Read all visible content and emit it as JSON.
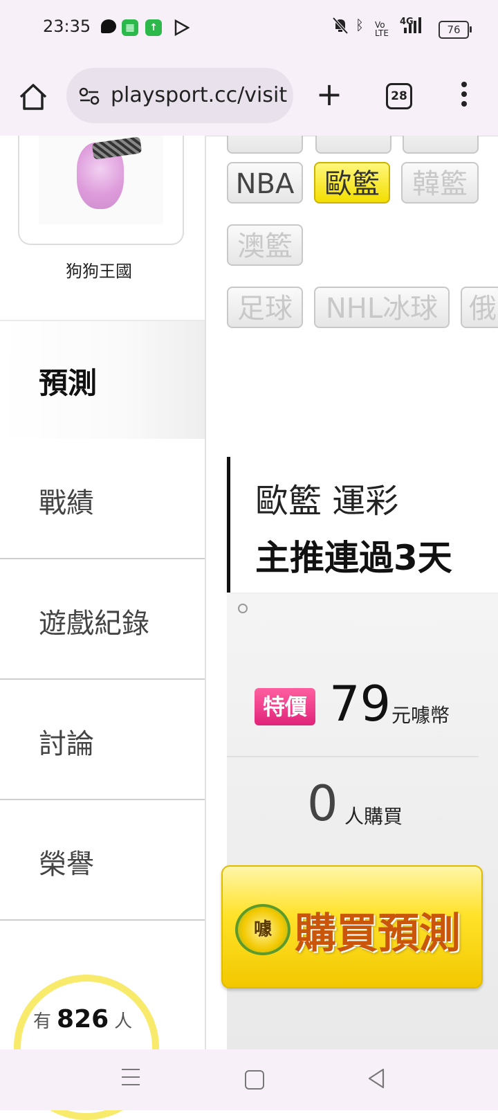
{
  "status_bar": {
    "time": "23:35",
    "network": "4G",
    "volte": "Vo LTE",
    "battery": "76",
    "icons": [
      "chat-icon",
      "app-icon",
      "upload-icon",
      "play-store-icon",
      "mute-icon",
      "bluetooth-icon",
      "signal-icon",
      "battery-icon"
    ]
  },
  "browser": {
    "url": "playsport.cc/visit",
    "tab_count": "28"
  },
  "sidebar": {
    "username": "狗狗王國",
    "active_item": "預測",
    "items": [
      "戰績",
      "遊戲紀錄",
      "討論",
      "榮譽"
    ],
    "visitors": {
      "prefix": "有",
      "count": "826",
      "suffix": "人"
    }
  },
  "league_buttons": {
    "row1": [
      "NBA",
      "歐籃",
      "韓籃"
    ],
    "row2": [
      "澳籃"
    ],
    "row3": [
      "足球",
      "NHL冰球",
      "俄"
    ],
    "selected": "歐籃"
  },
  "prediction": {
    "title_line1": "歐籃 運彩",
    "title_line2": "主推連過3天",
    "badge": "特價",
    "price": "79",
    "price_unit": "元噱幣",
    "buyers_count": "0",
    "buyers_label": "人購買",
    "buy_button": "購買預測",
    "buy_coin": "噱"
  },
  "colors": {
    "selected_button": "#f3de00",
    "sale_badge": "#e0247a",
    "buy_button_text": "#c9560a"
  }
}
